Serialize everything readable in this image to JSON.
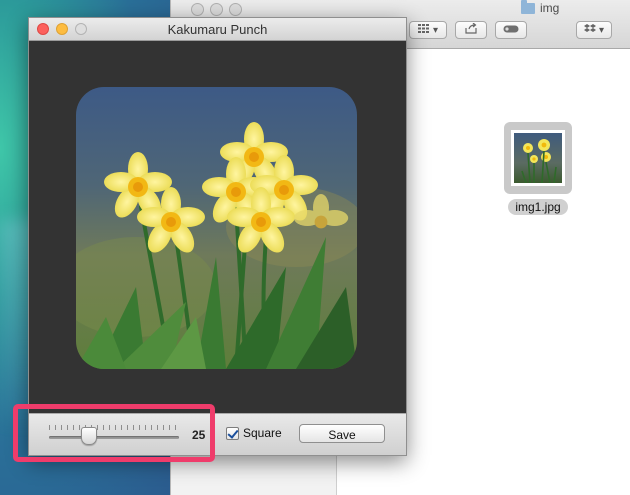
{
  "finder": {
    "title": "img",
    "file_label": "img1.jpg"
  },
  "app": {
    "title": "Kakumaru Punch",
    "slider_value": "25",
    "slider_fraction": 0.3,
    "checkbox_label": "Square",
    "checkbox_checked": true,
    "save_label": "Save"
  },
  "colors": {
    "highlight": "#ef3c6b",
    "canvas_bg": "#333333"
  },
  "icons": {
    "view_mode": "grid-view-icon",
    "share": "share-icon",
    "tag": "tag-icon",
    "dropbox": "dropbox-icon"
  }
}
